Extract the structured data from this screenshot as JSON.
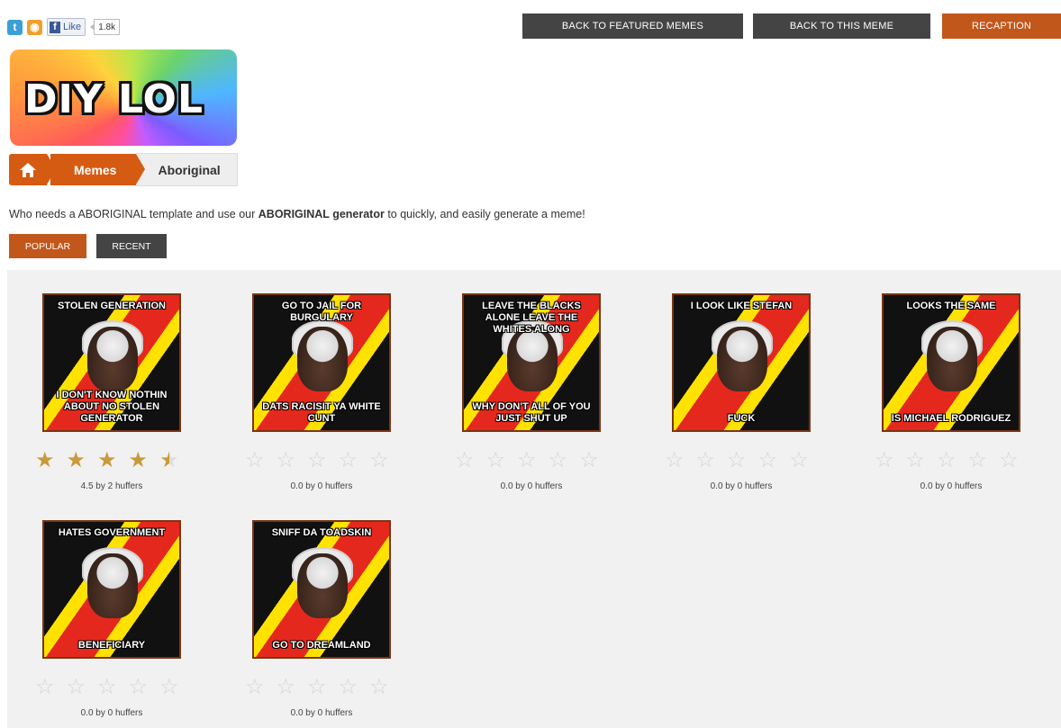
{
  "social": {
    "twitter_icon": "twitter-icon",
    "rss_icon": "rss-icon",
    "like_label": "Like",
    "like_count": "1.8k"
  },
  "nav": {
    "featured": "BACK TO FEATURED MEMES",
    "this_meme": "BACK TO THIS MEME",
    "recaption": "RECAPTION"
  },
  "logo": {
    "text": "DIY LOL"
  },
  "breadcrumb": {
    "home_icon": "home-icon",
    "memes": "Memes",
    "current": "Aboriginal"
  },
  "description": {
    "part1": "Who needs a ABORIGINAL template and use our ",
    "bold": "ABORIGINAL generator",
    "part2": " to quickly, and easily generate a meme!"
  },
  "sort": {
    "popular": "POPULAR",
    "recent": "RECENT"
  },
  "memes": [
    {
      "top": "STOLEN GENERATION",
      "bottom": "I DON'T KNOW NOTHIN ABOUT NO STOLEN GENERATOR",
      "rating": 4.5,
      "rating_text": "4.5 by 2 huffers"
    },
    {
      "top": "GO TO JAIL FOR BURGULARY",
      "bottom": "DATS RACISIT YA WHITE CUNT",
      "rating": 0,
      "rating_text": "0.0 by 0 huffers"
    },
    {
      "top": "LEAVE THE BLACKS ALONE LEAVE THE WHITES ALONG",
      "bottom": "WHY DON'T ALL OF YOU JUST SHUT UP",
      "rating": 0,
      "rating_text": "0.0 by 0 huffers"
    },
    {
      "top": "I LOOK LIKE STEFAN",
      "bottom": "FUCK",
      "rating": 0,
      "rating_text": "0.0 by 0 huffers"
    },
    {
      "top": "LOOKS THE SAME",
      "bottom": "IS MICHAEL RODRIGUEZ",
      "rating": 0,
      "rating_text": "0.0 by 0 huffers"
    },
    {
      "top": "HATES GOVERNMENT",
      "bottom": "BENEFICIARY",
      "rating": 0,
      "rating_text": "0.0 by 0 huffers"
    },
    {
      "top": "SNIFF DA TOADSKIN",
      "bottom": "GO TO DREAMLAND",
      "rating": 0,
      "rating_text": "0.0 by 0 huffers"
    }
  ]
}
